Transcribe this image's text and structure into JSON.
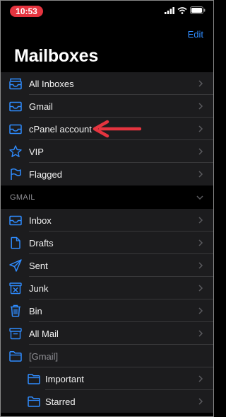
{
  "status_bar": {
    "time": "10:53"
  },
  "header": {
    "edit_label": "Edit",
    "title": "Mailboxes"
  },
  "mailboxes": [
    {
      "label": "All Inboxes",
      "icon": "inbox-stack-icon"
    },
    {
      "label": "Gmail",
      "icon": "inbox-icon"
    },
    {
      "label": "cPanel account",
      "icon": "inbox-icon"
    },
    {
      "label": "VIP",
      "icon": "star-icon"
    },
    {
      "label": "Flagged",
      "icon": "flag-icon"
    }
  ],
  "gmail_section": {
    "title": "GMAIL",
    "items": [
      {
        "label": "Inbox",
        "icon": "inbox-icon"
      },
      {
        "label": "Drafts",
        "icon": "document-icon"
      },
      {
        "label": "Sent",
        "icon": "paper-plane-icon"
      },
      {
        "label": "Junk",
        "icon": "junk-bin-icon"
      },
      {
        "label": "Bin",
        "icon": "trash-icon"
      },
      {
        "label": "All Mail",
        "icon": "archive-box-icon"
      },
      {
        "label": "[Gmail]",
        "icon": "folder-icon"
      },
      {
        "label": "Important",
        "icon": "folder-icon"
      },
      {
        "label": "Starred",
        "icon": "folder-icon"
      }
    ]
  },
  "colors": {
    "accent": "#2f8cff",
    "annotation": "#e5343f",
    "row_bg": "#1c1c1e",
    "background": "#000000"
  }
}
